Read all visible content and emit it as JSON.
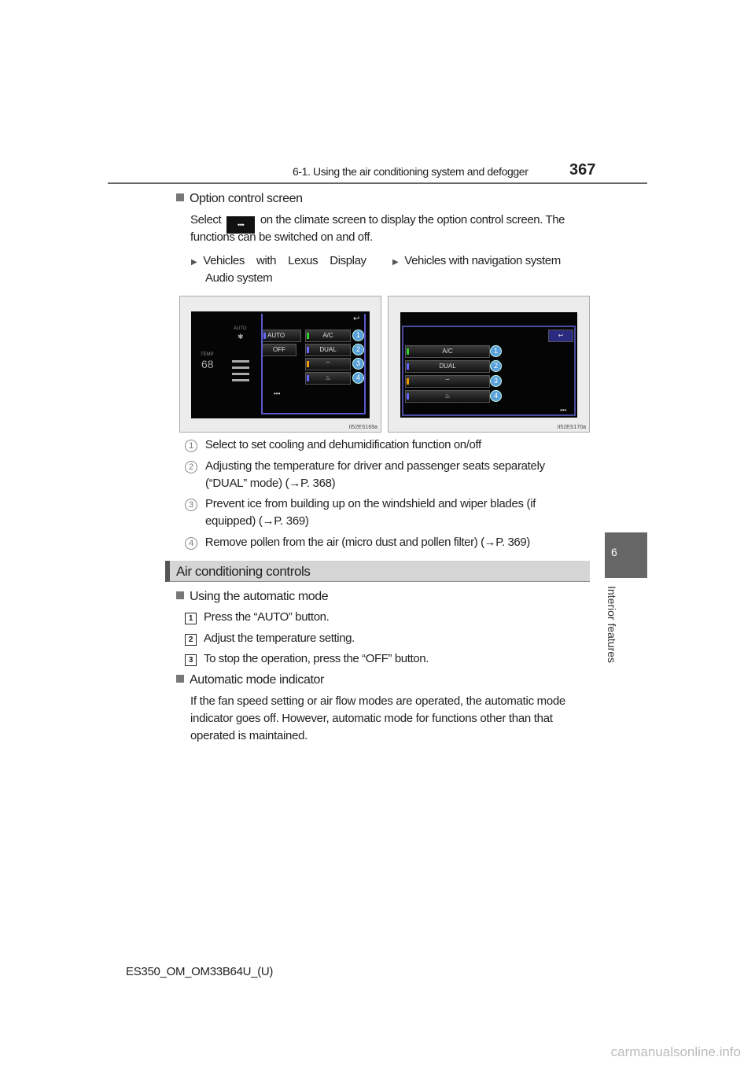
{
  "header": {
    "section_title": "6-1. Using the air conditioning system and defogger",
    "page_number": "367"
  },
  "option": {
    "heading": "Option control screen",
    "body_before": "Select",
    "button_icon": "three-dots-icon",
    "button_label": "•••",
    "body_after": "on the climate screen to display the option control screen. The",
    "body_line2": "functions can be switched on and off.",
    "variant_left_line1": "Vehicles    with    Lexus    Display",
    "variant_left_line2": "Audio system",
    "variant_right": "Vehicles with navigation system"
  },
  "figure_left": {
    "code": "II52ES169a",
    "auto_small": "AUTO",
    "temp_label": "TEMP",
    "temp_value": "68",
    "auto_btn": "AUTO",
    "off_btn": "OFF",
    "ac": "A/C",
    "dual": "DUAL",
    "dots": "•••",
    "numbers": [
      "1",
      "2",
      "3",
      "4"
    ]
  },
  "figure_right": {
    "code": "II52ES170a",
    "ac": "A/C",
    "dual": "DUAL",
    "dots": "•••",
    "numbers": [
      "1",
      "2",
      "3",
      "4"
    ]
  },
  "callouts": [
    {
      "num": "1",
      "text": "Select to set cooling and dehumidification function on/off"
    },
    {
      "num": "2",
      "line1": "Adjusting the temperature for driver and passenger seats separately",
      "line2": "(“DUAL” mode) (→P. 368)"
    },
    {
      "num": "3",
      "line1": "Prevent ice from building up on the windshield and wiper blades (if",
      "line2": "equipped) (→P. 369)"
    },
    {
      "num": "4",
      "text": "Remove pollen from the air (micro dust and pollen filter) (→P. 369)"
    }
  ],
  "section": {
    "title": "Air conditioning controls"
  },
  "auto_mode": {
    "heading": "Using the automatic mode",
    "steps": [
      {
        "num": "1",
        "text": "Press the “AUTO” button."
      },
      {
        "num": "2",
        "text": "Adjust the temperature setting."
      },
      {
        "num": "3",
        "text": "To stop the operation, press the “OFF” button."
      }
    ]
  },
  "indicator": {
    "heading": "Automatic mode indicator",
    "lines": [
      "If the fan speed setting or air flow modes are operated, the automatic mode",
      "indicator goes off. However, automatic mode for functions other than that",
      "operated is maintained."
    ]
  },
  "side_tab": {
    "number": "6",
    "label": "Interior features"
  },
  "footer": {
    "code": "ES350_OM_OM33B64U_(U)"
  },
  "watermark": "carmanualsonline.info"
}
